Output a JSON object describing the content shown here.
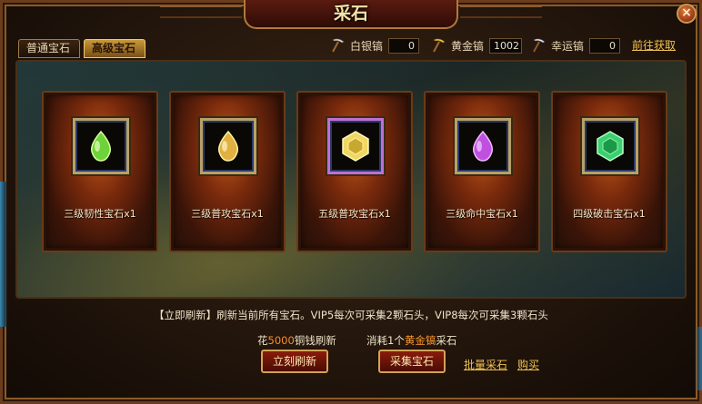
{
  "window": {
    "title": "采石",
    "close_glyph": "×"
  },
  "tabs": [
    {
      "label": "普通宝石",
      "active": false
    },
    {
      "label": "高级宝石",
      "active": true
    }
  ],
  "picks": {
    "silver": {
      "label": "白银镐",
      "value": "0",
      "icon": "silver-pickaxe-icon"
    },
    "gold": {
      "label": "黄金镐",
      "value": "1002",
      "icon": "gold-pickaxe-icon"
    },
    "lucky": {
      "label": "幸运镐",
      "value": "0",
      "icon": "lucky-pickaxe-icon"
    },
    "goto_label": "前往获取"
  },
  "gems": [
    {
      "label": "三级韧性宝石x1",
      "color": "#6ed23a",
      "shape": "drop"
    },
    {
      "label": "三级普攻宝石x1",
      "color": "#e0b040",
      "shape": "drop"
    },
    {
      "label": "五级普攻宝石x1",
      "color": "#f0d860",
      "shape": "hex"
    },
    {
      "label": "三级命中宝石x1",
      "color": "#c050e0",
      "shape": "drop"
    },
    {
      "label": "四级破击宝石x1",
      "color": "#3ad070",
      "shape": "hex"
    }
  ],
  "notice": {
    "tag": "【立即刷新】",
    "text": "刷新当前所有宝石。VIP5每次可采集2颗石头，VIP8每次可采集3颗石头"
  },
  "refresh": {
    "prefix": "花",
    "cost": "5000",
    "suffix": "铜钱刷新",
    "button": "立刻刷新"
  },
  "collect": {
    "prefix": "消耗1个",
    "item": "黄金镐",
    "suffix": "采石",
    "button": "采集宝石"
  },
  "links": {
    "batch": "批量采石",
    "buy": "购买"
  }
}
